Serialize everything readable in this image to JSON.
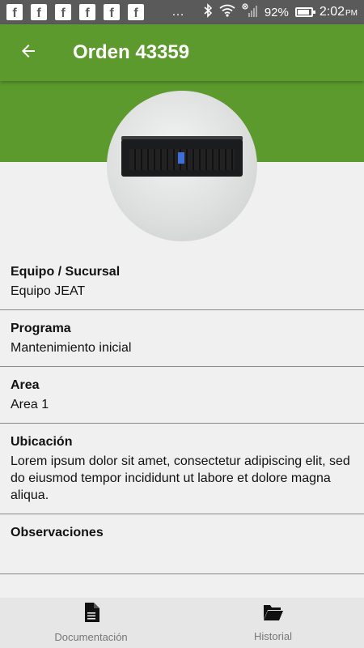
{
  "status_bar": {
    "notification_icons": [
      "f",
      "f",
      "f",
      "f",
      "f",
      "f"
    ],
    "more": "…",
    "battery": "92%",
    "time": "2:02",
    "ampm": "PM"
  },
  "app_bar": {
    "title": "Orden 43359"
  },
  "fields": [
    {
      "label": "Equipo / Sucursal",
      "value": "Equipo JEAT"
    },
    {
      "label": "Programa",
      "value": "Mantenimiento inicial"
    },
    {
      "label": "Area",
      "value": "Area 1"
    },
    {
      "label": "Ubicación",
      "value": "Lorem ipsum dolor sit amet, consectetur adipiscing elit, sed do eiusmod tempor incididunt ut labore et dolore magna aliqua."
    },
    {
      "label": "Observaciones",
      "value": ""
    }
  ],
  "bottom_nav": {
    "documentacion": {
      "label": "Documentación",
      "icon": "document-icon"
    },
    "historial": {
      "label": "Historial",
      "icon": "folder-open-icon"
    }
  },
  "colors": {
    "primary": "#5c9a2e",
    "status_bar": "#5a5a5a",
    "background": "#f0f0f0"
  }
}
